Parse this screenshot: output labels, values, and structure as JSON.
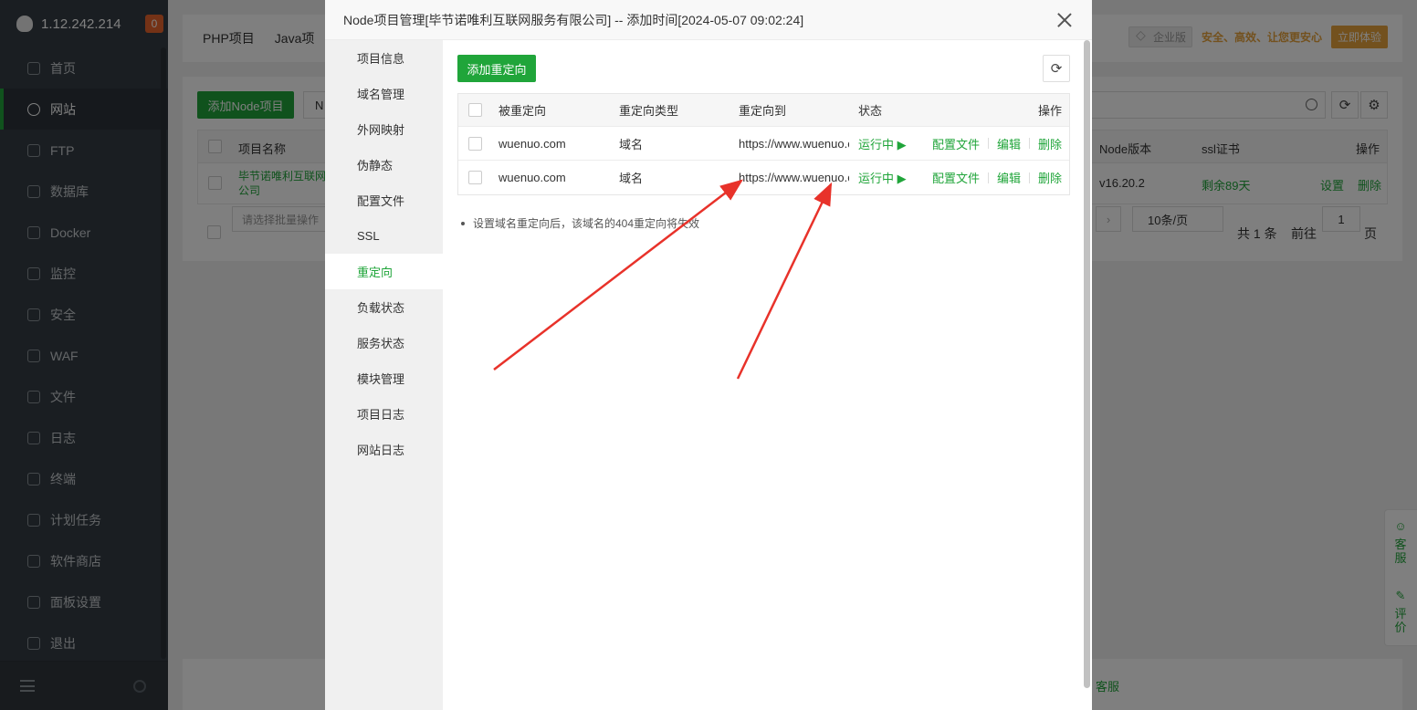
{
  "sidebar": {
    "ip": "1.12.242.214",
    "badge": "0",
    "items": [
      "首页",
      "网站",
      "FTP",
      "数据库",
      "Docker",
      "监控",
      "安全",
      "WAF",
      "文件",
      "日志",
      "终端",
      "计划任务",
      "软件商店",
      "面板设置",
      "退出"
    ],
    "active_index": 1
  },
  "background": {
    "tabs": [
      "PHP项目",
      "Java项"
    ],
    "enterprise_badge": "企业版",
    "promo_text": "安全、高效、让您更安心",
    "try_button": "立即体验",
    "add_project_button": "添加Node项目",
    "select_fragment": "N",
    "headers": {
      "name": "项目名称",
      "node_version": "Node版本",
      "ssl": "ssl证书",
      "actions": "操作"
    },
    "row": {
      "name_line1": "毕节诺唯利互联网",
      "name_line2": "公司",
      "node_version": "v16.20.2",
      "ssl": "剩余89天",
      "settings": "设置",
      "delete": "删除"
    },
    "batch_placeholder": "请选择批量操作",
    "pager": {
      "page_size": "10条/页",
      "total": "共 1 条",
      "goto": "前往",
      "page": "1",
      "page_unit": "页"
    },
    "footer_fragment": "客服"
  },
  "support": {
    "service": "客服",
    "review": "评价"
  },
  "modal": {
    "title": "Node项目管理[毕节诺唯利互联网服务有限公司] -- 添加时间[2024-05-07 09:02:24]",
    "nav": [
      "项目信息",
      "域名管理",
      "外网映射",
      "伪静态",
      "配置文件",
      "SSL",
      "重定向",
      "负载状态",
      "服务状态",
      "模块管理",
      "项目日志",
      "网站日志"
    ],
    "active_nav_index": 6,
    "add_button": "添加重定向",
    "table": {
      "headers": {
        "source": "被重定向",
        "type": "重定向类型",
        "target": "重定向到",
        "status": "状态",
        "actions": "操作"
      },
      "rows": [
        {
          "source": "wuenuo.com",
          "type": "域名",
          "target": "https://www.wuenuo.com",
          "status": "运行中 ▶",
          "config": "配置文件",
          "edit": "编辑",
          "delete": "删除"
        },
        {
          "source": "wuenuo.com",
          "type": "域名",
          "target": "https://www.wuenuo.com",
          "status": "运行中 ▶",
          "config": "配置文件",
          "edit": "编辑",
          "delete": "删除"
        }
      ]
    },
    "note": "设置域名重定向后，该域名的404重定向将失效"
  },
  "colors": {
    "accent": "#20a53a",
    "sidebar_bg": "#353d44",
    "annotation_arrow": "#e8322a",
    "promo": "#e6a23c"
  }
}
